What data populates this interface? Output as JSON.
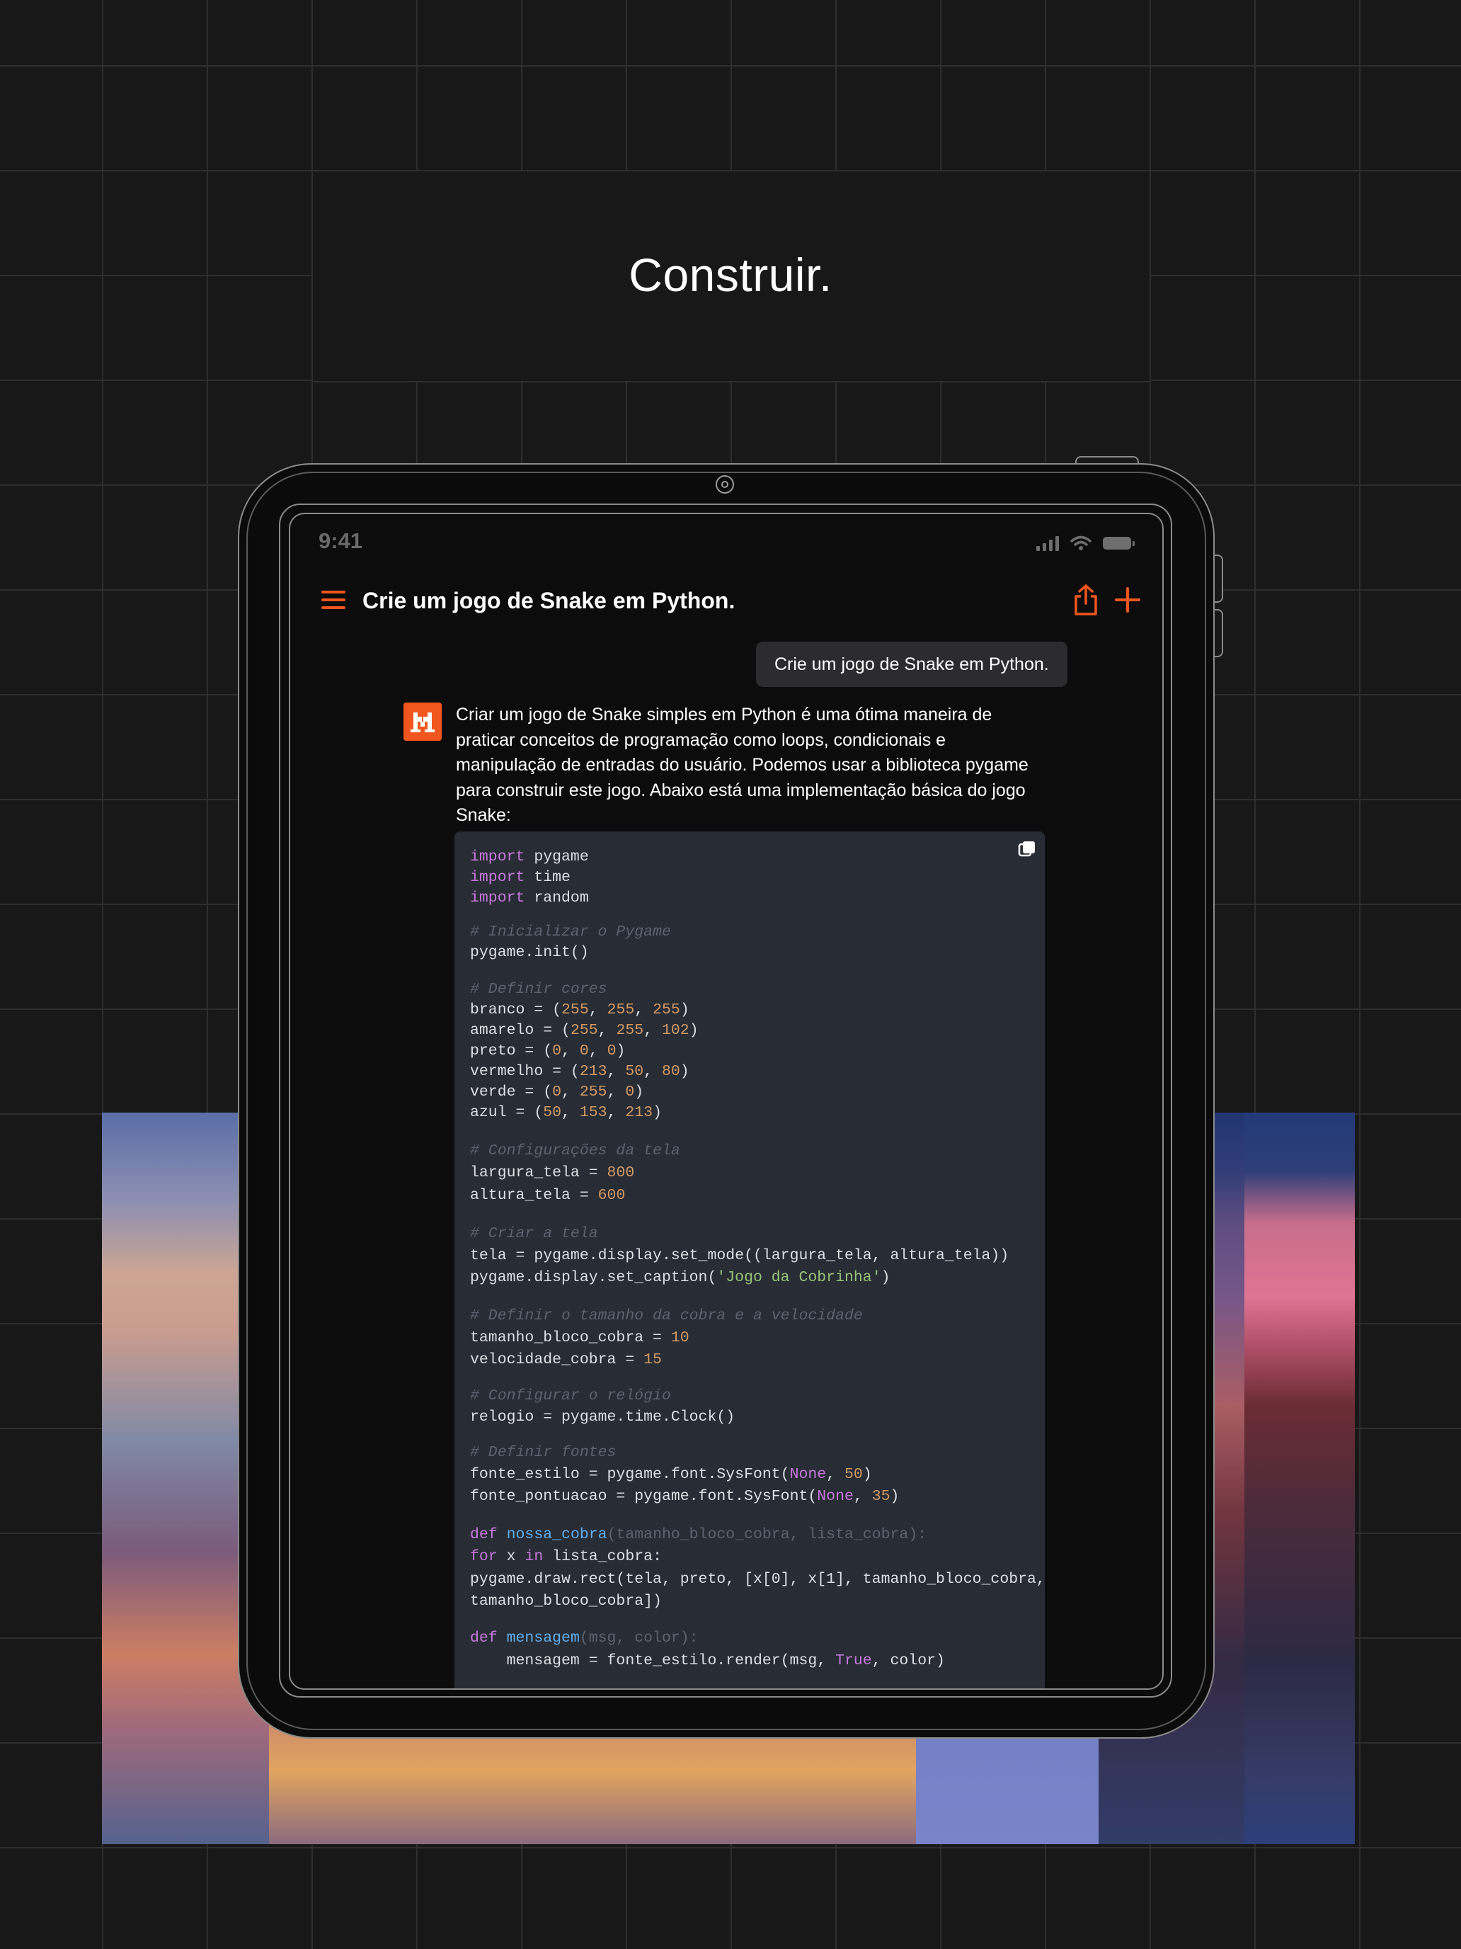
{
  "headline": "Construir.",
  "status_bar": {
    "time": "9:41"
  },
  "header": {
    "title": "Crie um jogo de Snake em Python."
  },
  "conversation": {
    "user_message": "Crie um jogo de Snake em Python.",
    "assistant_intro": "Criar um jogo de Snake simples em Python é uma ótima maneira de praticar conceitos de programação como loops, condicionais e manipulação de entradas do usuário. Podemos usar a biblioteca pygame para construir este jogo. Abaixo está uma implementação básica do jogo Snake:"
  },
  "code": {
    "l1_kw": "import",
    "l1_rest": " pygame",
    "l2_kw": "import",
    "l2_rest": " time",
    "l3_kw": "import",
    "l3_rest": " random",
    "c1": "# Inicializar o Pygame",
    "l4": "pygame.init()",
    "c2": "# Definir cores",
    "branco_a": "branco = (",
    "branco_n1": "255",
    "sep": ", ",
    "branco_n2": "255",
    "branco_n3": "255",
    "close": ")",
    "amarelo_a": "amarelo = (",
    "amarelo_n1": "255",
    "amarelo_n2": "255",
    "amarelo_n3": "102",
    "preto_a": "preto = (",
    "preto_n1": "0",
    "preto_n2": "0",
    "preto_n3": "0",
    "vermelho_a": "vermelho = (",
    "vermelho_n1": "213",
    "vermelho_n2": "50",
    "vermelho_n3": "80",
    "verde_a": "verde = (",
    "verde_n1": "0",
    "verde_n2": "255",
    "verde_n3": "0",
    "azul_a": "azul = (",
    "azul_n1": "50",
    "azul_n2": "153",
    "azul_n3": "213",
    "c3": "# Configurações da tela",
    "largura_a": "largura_tela = ",
    "largura_n": "800",
    "altura_a": "altura_tela = ",
    "altura_n": "600",
    "c4": "# Criar a tela",
    "tela": "tela = pygame.display.set_mode((largura_tela, altura_tela))",
    "caption_a": "pygame.display.set_caption(",
    "caption_s": "'Jogo da Cobrinha'",
    "caption_b": ")",
    "c5": "# Definir o tamanho da cobra e a velocidade",
    "bloco_a": "tamanho_bloco_cobra = ",
    "bloco_n": "10",
    "vel_a": "velocidade_cobra = ",
    "vel_n": "15",
    "c6": "# Configurar o relógio",
    "relogio": "relogio = pygame.time.Clock()",
    "c7": "# Definir fontes",
    "fe_a": "fonte_estilo = pygame.font.SysFont(",
    "none": "None",
    "fe_n": "50",
    "fp_a": "fonte_pontuacao = pygame.font.SysFont(",
    "fp_n": "35",
    "def": "def",
    "fn1": "nossa_cobra",
    "fn1_args": "(tamanho_bloco_cobra, lista_cobra):",
    "for_kw": "for",
    "for_mid": " x ",
    "in_kw": "in",
    "for_rest": " lista_cobra:",
    "draw1": "pygame.draw.rect(tela, preto, [x[0], x[1], tamanho_bloco_cobra,",
    "draw2": "tamanho_bloco_cobra])",
    "fn2": "mensagem",
    "fn2_args": "(msg, color):",
    "msg_a": "    mensagem = fonte_estilo.render(msg, ",
    "true": "True",
    "msg_b": ", color)"
  },
  "icons": {
    "menu": "hamburger-menu-icon",
    "share": "share-icon",
    "new": "plus-icon",
    "copy": "copy-icon",
    "avatar": "mistral-logo-icon"
  },
  "colors": {
    "accent": "#f1561e",
    "background": "#181818",
    "code_bg": "#282c34",
    "keyword": "#c678dd",
    "number": "#d19a66",
    "string": "#98c379",
    "comment": "#5c6370",
    "function": "#61afef"
  }
}
